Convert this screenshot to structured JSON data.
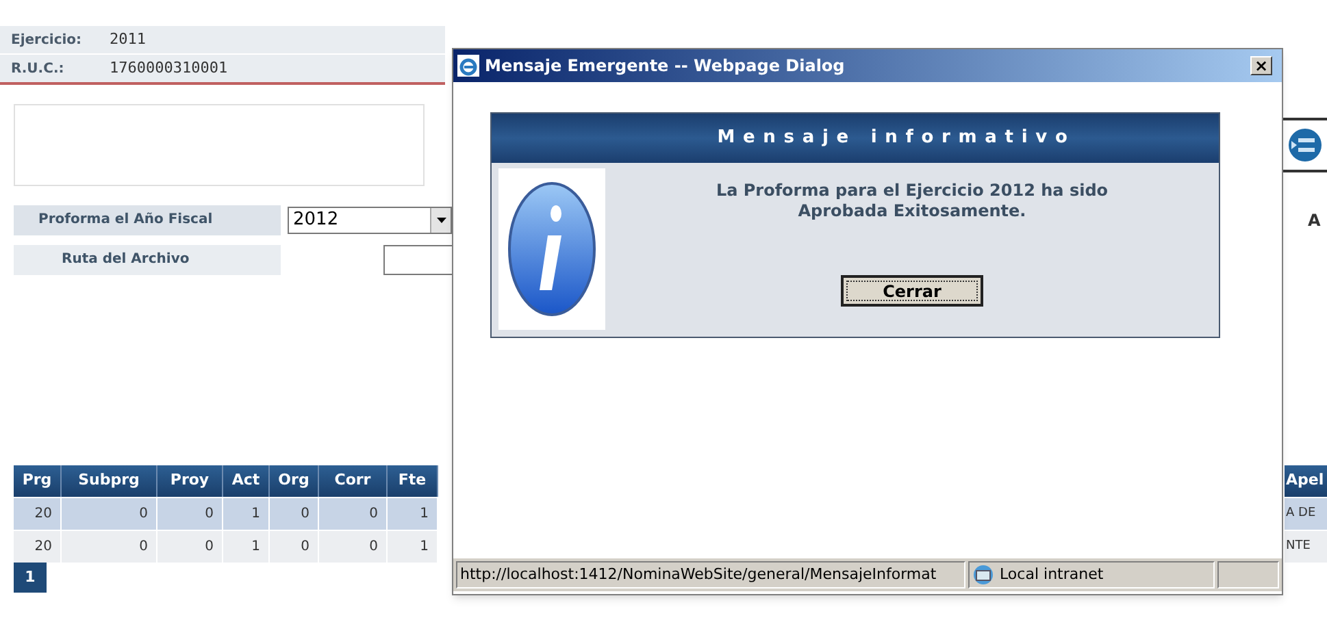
{
  "page": {
    "fields": [
      {
        "label": "Ejercicio:",
        "value": "2011"
      },
      {
        "label": "R.U.C.:",
        "value": "1760000310001"
      }
    ],
    "form": {
      "fiscal_year": {
        "label": "Proforma el Año Fiscal",
        "value": "2012"
      },
      "file_path": {
        "label": "Ruta del Archivo"
      },
      "side_label": "A"
    },
    "table": {
      "columns": [
        "Prg",
        "Subprg",
        "Proy",
        "Act",
        "Org",
        "Corr",
        "Fte"
      ],
      "rows": [
        {
          "cells": [
            "20",
            "0",
            "0",
            "1",
            "0",
            "0",
            "1"
          ],
          "edge_cell": "A DE"
        },
        {
          "cells": [
            "20",
            "0",
            "0",
            "1",
            "0",
            "0",
            "1"
          ],
          "edge_cell": "NTE"
        }
      ],
      "edge_column": "Apel"
    },
    "pager": [
      {
        "label": "1",
        "selected": true
      }
    ]
  },
  "dialog": {
    "title": "Mensaje Emergente -- Webpage Dialog",
    "close": "×",
    "header": "Mensaje informativo",
    "message": "La Proforma para el Ejercicio 2012 ha sido Aprobada Exitosamente.",
    "button": "Cerrar",
    "status_bar": {
      "url": "http://localhost:1412/NominaWebSite/general/MensajeInformat",
      "zone": "Local intranet"
    }
  }
}
